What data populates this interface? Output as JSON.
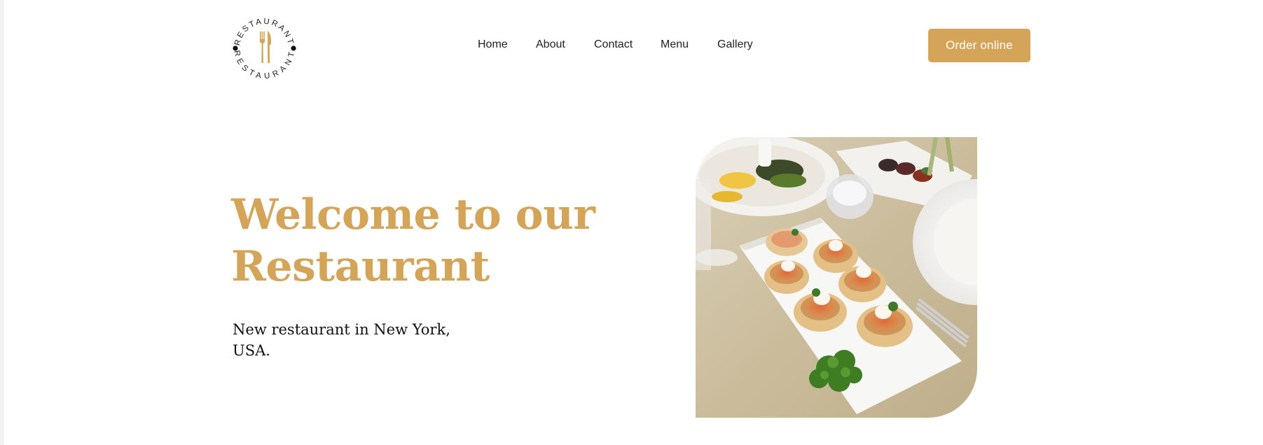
{
  "brand": {
    "logo_text_top": "RESTAURANT",
    "logo_text_bottom": "RESTAURANT",
    "logo_icon": "fork-knife-icon"
  },
  "nav": {
    "items": [
      {
        "label": "Home"
      },
      {
        "label": "About"
      },
      {
        "label": "Contact"
      },
      {
        "label": "Menu"
      },
      {
        "label": "Gallery"
      }
    ]
  },
  "header": {
    "order_label": "Order online"
  },
  "hero": {
    "title_line1": "Welcome to our",
    "title_line2": "Restaurant",
    "subtitle_line1": "New restaurant in New York,",
    "subtitle_line2": "USA.",
    "image_alt": "Plated appetizers of salmon tartlets with cream and parsley"
  },
  "colors": {
    "accent": "#d4a559",
    "text_dark": "#111111",
    "background": "#ffffff"
  }
}
